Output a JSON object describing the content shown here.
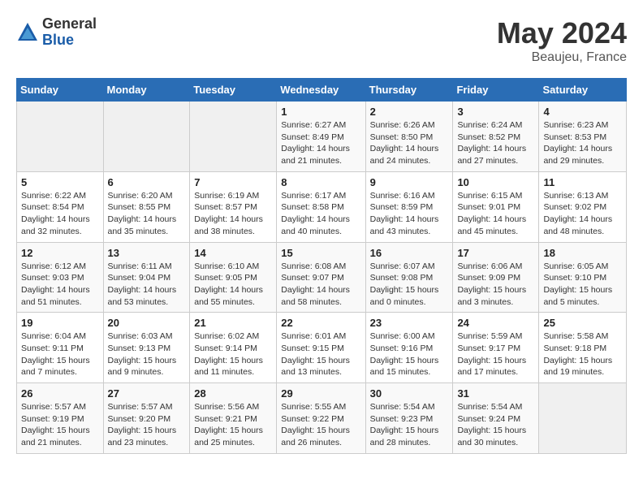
{
  "header": {
    "logo_general": "General",
    "logo_blue": "Blue",
    "month_title": "May 2024",
    "location": "Beaujeu, France"
  },
  "weekdays": [
    "Sunday",
    "Monday",
    "Tuesday",
    "Wednesday",
    "Thursday",
    "Friday",
    "Saturday"
  ],
  "weeks": [
    [
      {
        "day": "",
        "info": ""
      },
      {
        "day": "",
        "info": ""
      },
      {
        "day": "",
        "info": ""
      },
      {
        "day": "1",
        "info": "Sunrise: 6:27 AM\nSunset: 8:49 PM\nDaylight: 14 hours\nand 21 minutes."
      },
      {
        "day": "2",
        "info": "Sunrise: 6:26 AM\nSunset: 8:50 PM\nDaylight: 14 hours\nand 24 minutes."
      },
      {
        "day": "3",
        "info": "Sunrise: 6:24 AM\nSunset: 8:52 PM\nDaylight: 14 hours\nand 27 minutes."
      },
      {
        "day": "4",
        "info": "Sunrise: 6:23 AM\nSunset: 8:53 PM\nDaylight: 14 hours\nand 29 minutes."
      }
    ],
    [
      {
        "day": "5",
        "info": "Sunrise: 6:22 AM\nSunset: 8:54 PM\nDaylight: 14 hours\nand 32 minutes."
      },
      {
        "day": "6",
        "info": "Sunrise: 6:20 AM\nSunset: 8:55 PM\nDaylight: 14 hours\nand 35 minutes."
      },
      {
        "day": "7",
        "info": "Sunrise: 6:19 AM\nSunset: 8:57 PM\nDaylight: 14 hours\nand 38 minutes."
      },
      {
        "day": "8",
        "info": "Sunrise: 6:17 AM\nSunset: 8:58 PM\nDaylight: 14 hours\nand 40 minutes."
      },
      {
        "day": "9",
        "info": "Sunrise: 6:16 AM\nSunset: 8:59 PM\nDaylight: 14 hours\nand 43 minutes."
      },
      {
        "day": "10",
        "info": "Sunrise: 6:15 AM\nSunset: 9:01 PM\nDaylight: 14 hours\nand 45 minutes."
      },
      {
        "day": "11",
        "info": "Sunrise: 6:13 AM\nSunset: 9:02 PM\nDaylight: 14 hours\nand 48 minutes."
      }
    ],
    [
      {
        "day": "12",
        "info": "Sunrise: 6:12 AM\nSunset: 9:03 PM\nDaylight: 14 hours\nand 51 minutes."
      },
      {
        "day": "13",
        "info": "Sunrise: 6:11 AM\nSunset: 9:04 PM\nDaylight: 14 hours\nand 53 minutes."
      },
      {
        "day": "14",
        "info": "Sunrise: 6:10 AM\nSunset: 9:05 PM\nDaylight: 14 hours\nand 55 minutes."
      },
      {
        "day": "15",
        "info": "Sunrise: 6:08 AM\nSunset: 9:07 PM\nDaylight: 14 hours\nand 58 minutes."
      },
      {
        "day": "16",
        "info": "Sunrise: 6:07 AM\nSunset: 9:08 PM\nDaylight: 15 hours\nand 0 minutes."
      },
      {
        "day": "17",
        "info": "Sunrise: 6:06 AM\nSunset: 9:09 PM\nDaylight: 15 hours\nand 3 minutes."
      },
      {
        "day": "18",
        "info": "Sunrise: 6:05 AM\nSunset: 9:10 PM\nDaylight: 15 hours\nand 5 minutes."
      }
    ],
    [
      {
        "day": "19",
        "info": "Sunrise: 6:04 AM\nSunset: 9:11 PM\nDaylight: 15 hours\nand 7 minutes."
      },
      {
        "day": "20",
        "info": "Sunrise: 6:03 AM\nSunset: 9:13 PM\nDaylight: 15 hours\nand 9 minutes."
      },
      {
        "day": "21",
        "info": "Sunrise: 6:02 AM\nSunset: 9:14 PM\nDaylight: 15 hours\nand 11 minutes."
      },
      {
        "day": "22",
        "info": "Sunrise: 6:01 AM\nSunset: 9:15 PM\nDaylight: 15 hours\nand 13 minutes."
      },
      {
        "day": "23",
        "info": "Sunrise: 6:00 AM\nSunset: 9:16 PM\nDaylight: 15 hours\nand 15 minutes."
      },
      {
        "day": "24",
        "info": "Sunrise: 5:59 AM\nSunset: 9:17 PM\nDaylight: 15 hours\nand 17 minutes."
      },
      {
        "day": "25",
        "info": "Sunrise: 5:58 AM\nSunset: 9:18 PM\nDaylight: 15 hours\nand 19 minutes."
      }
    ],
    [
      {
        "day": "26",
        "info": "Sunrise: 5:57 AM\nSunset: 9:19 PM\nDaylight: 15 hours\nand 21 minutes."
      },
      {
        "day": "27",
        "info": "Sunrise: 5:57 AM\nSunset: 9:20 PM\nDaylight: 15 hours\nand 23 minutes."
      },
      {
        "day": "28",
        "info": "Sunrise: 5:56 AM\nSunset: 9:21 PM\nDaylight: 15 hours\nand 25 minutes."
      },
      {
        "day": "29",
        "info": "Sunrise: 5:55 AM\nSunset: 9:22 PM\nDaylight: 15 hours\nand 26 minutes."
      },
      {
        "day": "30",
        "info": "Sunrise: 5:54 AM\nSunset: 9:23 PM\nDaylight: 15 hours\nand 28 minutes."
      },
      {
        "day": "31",
        "info": "Sunrise: 5:54 AM\nSunset: 9:24 PM\nDaylight: 15 hours\nand 30 minutes."
      },
      {
        "day": "",
        "info": ""
      }
    ]
  ]
}
